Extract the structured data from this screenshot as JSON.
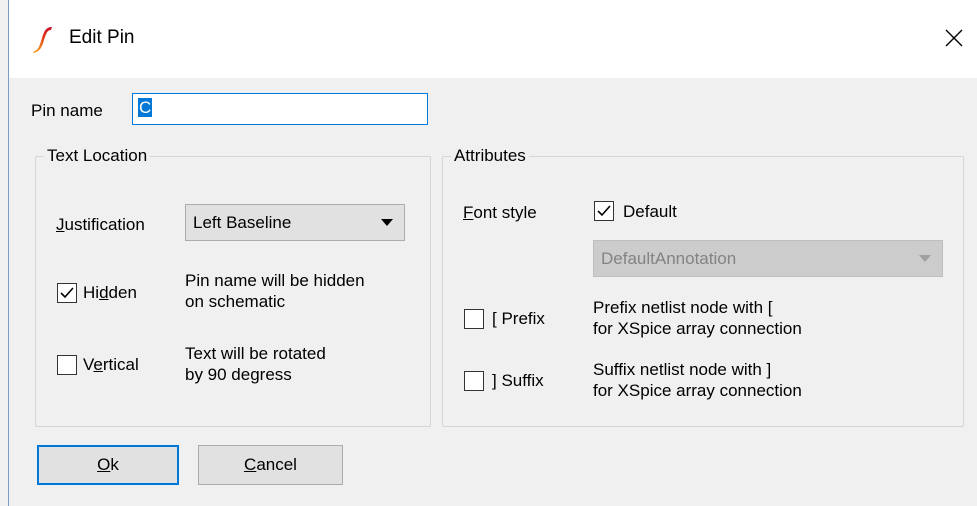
{
  "window": {
    "title": "Edit Pin",
    "app_icon": "simetrix-icon",
    "close_icon": "close-icon"
  },
  "pin_name": {
    "label": "Pin name",
    "value": "C"
  },
  "text_location": {
    "legend": "Text Location",
    "justification_label_first": "J",
    "justification_label_rest": "ustification",
    "justification_value": "Left Baseline",
    "hidden": {
      "label_pre": "Hi",
      "label_accel": "d",
      "label_post": "den",
      "checked": true,
      "desc_line1": "Pin name will be hidden",
      "desc_line2": "on schematic"
    },
    "vertical": {
      "label_pre": "V",
      "label_accel": "e",
      "label_post": "rtical",
      "checked": false,
      "desc_line1": "Text will be rotated",
      "desc_line2": "by 90 degress"
    }
  },
  "attributes": {
    "legend": "Attributes",
    "font_style_label_first": "F",
    "font_style_label_rest": "ont style",
    "default_checkbox": {
      "label": "Default",
      "checked": true
    },
    "font_combo_value": "DefaultAnnotation",
    "prefix": {
      "label": "[ Prefix",
      "checked": false,
      "desc_line1": "Prefix netlist node with [",
      "desc_line2": "for XSpice array connection"
    },
    "suffix": {
      "label": "] Suffix",
      "checked": false,
      "desc_line1": "Suffix netlist node with ]",
      "desc_line2": "for XSpice array connection"
    }
  },
  "buttons": {
    "ok_accel": "O",
    "ok_rest": "k",
    "cancel_accel": "C",
    "cancel_rest": "ancel"
  },
  "colors": {
    "accent": "#0078d7",
    "dialog_bg": "#f0f0f0",
    "icon_red": "#d81e1e",
    "icon_orange": "#f7a21b"
  }
}
